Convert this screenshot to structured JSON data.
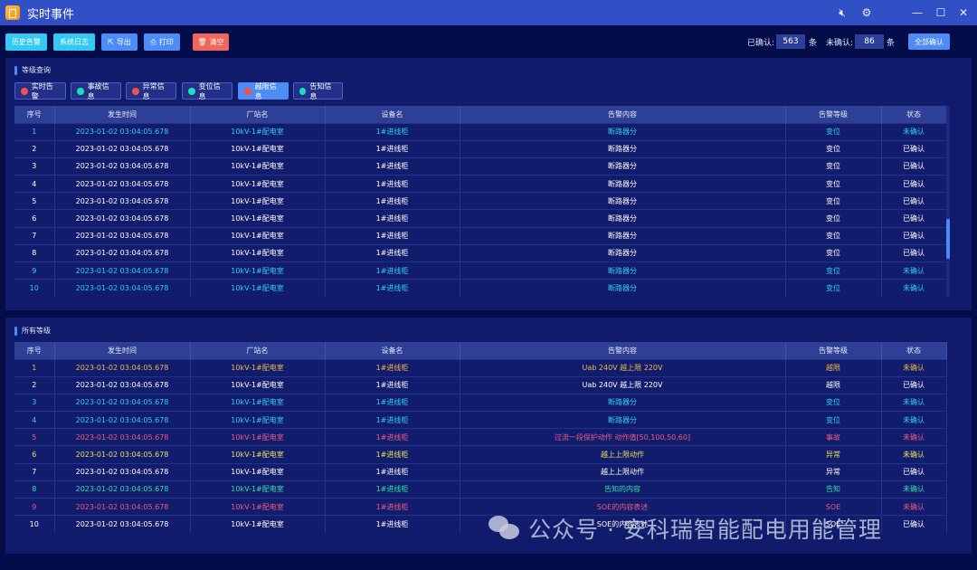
{
  "window": {
    "title": "实时事件",
    "icons": [
      "mute-icon",
      "gear-icon",
      "minimize-icon",
      "maximize-icon",
      "close-icon"
    ]
  },
  "toolbar": {
    "history_alarm": "历史告警",
    "system_log": "系统日志",
    "export": "导出",
    "print": "打印",
    "clear": "清空",
    "confirmed_label": "已确认:",
    "confirmed_count": "563",
    "unit1": "条",
    "unconfirmed_label": "未确认:",
    "unconfirmed_count": "86",
    "unit2": "条",
    "confirm_all": "全部确认"
  },
  "colors": {
    "title_bar": "#3250c6",
    "background": "#040c4a",
    "panel": "#101b6b",
    "header": "#2e3f96",
    "cyan": "#33c9f2",
    "blue": "#4d8cf5",
    "red": "#f0665a",
    "row_colors": {
      "white": "#ffffff",
      "cyan": "#2fd0f0",
      "orange": "#f2b84a",
      "pink": "#f05a84",
      "yellow": "#e6e060",
      "green": "#2fe0a8"
    }
  },
  "filter_panel": {
    "title": "等级查询",
    "filters": [
      {
        "label": "实时告警",
        "dot": "#f0524a",
        "active": false
      },
      {
        "label": "事故信息",
        "dot": "#19e0b8",
        "active": false
      },
      {
        "label": "异常信息",
        "dot": "#f0524a",
        "active": false
      },
      {
        "label": "变位信息",
        "dot": "#19e0b8",
        "active": false
      },
      {
        "label": "越限信息",
        "dot": "#f0524a",
        "active": true
      },
      {
        "label": "告知信息",
        "dot": "#19e0b8",
        "active": false
      }
    ]
  },
  "columns": [
    "序号",
    "发生时间",
    "厂站名",
    "设备名",
    "告警内容",
    "告警等级",
    "状态"
  ],
  "table1": {
    "rows": [
      {
        "c": "cyan",
        "cells": [
          "1",
          "2023-01-02  03:04:05.678",
          "10kV-1#配电室",
          "1#进线柜",
          "断路器分",
          "变位",
          "未确认"
        ]
      },
      {
        "c": "white",
        "cells": [
          "2",
          "2023-01-02  03:04:05.678",
          "10kV-1#配电室",
          "1#进线柜",
          "断路器分",
          "变位",
          "已确认"
        ]
      },
      {
        "c": "white",
        "cells": [
          "3",
          "2023-01-02  03:04:05.678",
          "10kV-1#配电室",
          "1#进线柜",
          "断路器分",
          "变位",
          "已确认"
        ]
      },
      {
        "c": "white",
        "cells": [
          "4",
          "2023-01-02  03:04:05.678",
          "10kV-1#配电室",
          "1#进线柜",
          "断路器分",
          "变位",
          "已确认"
        ]
      },
      {
        "c": "white",
        "cells": [
          "5",
          "2023-01-02  03:04:05.678",
          "10kV-1#配电室",
          "1#进线柜",
          "断路器分",
          "变位",
          "已确认"
        ]
      },
      {
        "c": "white",
        "cells": [
          "6",
          "2023-01-02  03:04:05.678",
          "10kV-1#配电室",
          "1#进线柜",
          "断路器分",
          "变位",
          "已确认"
        ]
      },
      {
        "c": "white",
        "cells": [
          "7",
          "2023-01-02  03:04:05.678",
          "10kV-1#配电室",
          "1#进线柜",
          "断路器分",
          "变位",
          "已确认"
        ]
      },
      {
        "c": "white",
        "cells": [
          "8",
          "2023-01-02  03:04:05.678",
          "10kV-1#配电室",
          "1#进线柜",
          "断路器分",
          "变位",
          "已确认"
        ]
      },
      {
        "c": "cyan",
        "cells": [
          "9",
          "2023-01-02  03:04:05.678",
          "10kV-1#配电室",
          "1#进线柜",
          "断路器分",
          "变位",
          "未确认"
        ]
      },
      {
        "c": "cyan",
        "cells": [
          "10",
          "2023-01-02  03:04:05.678",
          "10kV-1#配电室",
          "1#进线柜",
          "断路器分",
          "变位",
          "未确认"
        ]
      }
    ]
  },
  "all_panel": {
    "title": "所有等级"
  },
  "table2": {
    "rows": [
      {
        "c": "orange",
        "cells": [
          "1",
          "2023-01-02  03:04:05.678",
          "10kV-1#配电室",
          "1#进线柜",
          "Uab 240V 越上限 220V",
          "越限",
          "未确认"
        ]
      },
      {
        "c": "white",
        "cells": [
          "2",
          "2023-01-02  03:04:05.678",
          "10kV-1#配电室",
          "1#进线柜",
          "Uab 240V 越上限 220V",
          "越限",
          "已确认"
        ]
      },
      {
        "c": "cyan",
        "cells": [
          "3",
          "2023-01-02  03:04:05.678",
          "10kV-1#配电室",
          "1#进线柜",
          "断路器分",
          "变位",
          "未确认"
        ]
      },
      {
        "c": "cyan",
        "cells": [
          "4",
          "2023-01-02  03:04:05.678",
          "10kV-1#配电室",
          "1#进线柜",
          "断路器分",
          "变位",
          "未确认"
        ]
      },
      {
        "c": "pink",
        "cells": [
          "5",
          "2023-01-02  03:04:05.678",
          "10kV-1#配电室",
          "1#进线柜",
          "过流一段保护动作  动作值[50,100,50,60]",
          "事故",
          "未确认"
        ]
      },
      {
        "c": "yellow",
        "cells": [
          "6",
          "2023-01-02  03:04:05.678",
          "10kV-1#配电室",
          "1#进线柜",
          "越上上限动作",
          "异常",
          "未确认"
        ]
      },
      {
        "c": "white",
        "cells": [
          "7",
          "2023-01-02  03:04:05.678",
          "10kV-1#配电室",
          "1#进线柜",
          "越上上限动作",
          "异常",
          "已确认"
        ]
      },
      {
        "c": "green",
        "cells": [
          "8",
          "2023-01-02  03:04:05.678",
          "10kV-1#配电室",
          "1#进线柜",
          "告知的内容",
          "告知",
          "未确认"
        ]
      },
      {
        "c": "pink",
        "cells": [
          "9",
          "2023-01-02  03:04:05.678",
          "10kV-1#配电室",
          "1#进线柜",
          "SOE的内容表述",
          "SOE",
          "未确认"
        ]
      },
      {
        "c": "white",
        "cells": [
          "10",
          "2023-01-02  03:04:05.678",
          "10kV-1#配电室",
          "1#进线柜",
          "SOE的内容表述",
          "SOE",
          "已确认"
        ]
      }
    ]
  },
  "watermark": "公众号 · 安科瑞智能配电用能管理"
}
